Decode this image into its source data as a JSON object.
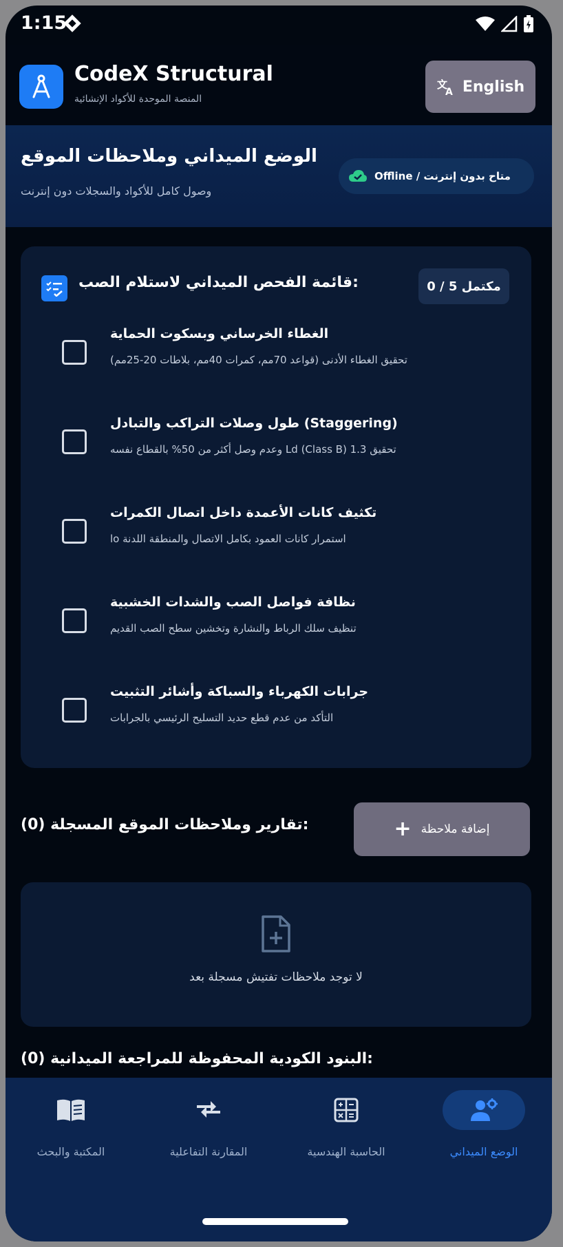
{
  "status_bar": {
    "time": "1:15"
  },
  "app": {
    "title": "CodeX Structural",
    "subtitle": "المنصة الموحدة للأكواد الإنشائية",
    "language_button": "English"
  },
  "banner": {
    "title": "الوضع الميداني وملاحظات الموقع",
    "subtitle": "وصول كامل للأكواد والسجلات دون إنترنت",
    "offline_badge": "Offline / متاح بدون إنترنت"
  },
  "checklist": {
    "title": "قائمة الفحص الميداني لاستلام الصب:",
    "progress": "مكتمل 5 / 0",
    "items": [
      {
        "title": "الغطاء الخرساني وبسكوت الحماية",
        "desc": "تحقيق الغطاء الأدنى (قواعد 70مم، كمرات 40مم، بلاطات 20-25مم)",
        "checked": false
      },
      {
        "title": "طول وصلات التراكب والتبادل (Staggering)",
        "desc": "وعدم وصل أكثر من 50% بالقطاع نفسه Ld (Class B) تحقيق 1.3",
        "checked": false
      },
      {
        "title": "تكثيف كانات الأعمدة داخل اتصال الكمرات",
        "desc": "lo استمرار كانات العمود بكامل الاتصال والمنطقة اللدنة",
        "checked": false
      },
      {
        "title": "نظافة فواصل الصب والشدات الخشبية",
        "desc": "تنظيف سلك الرباط والنشارة وتخشين سطح الصب القديم",
        "checked": false
      },
      {
        "title": "جرابات الكهرباء والسباكة وأشائر التثبيت",
        "desc": "التأكد من عدم قطع حديد التسليح الرئيسي بالجرابات",
        "checked": false
      }
    ]
  },
  "notes": {
    "title": "تقارير وملاحظات الموقع المسجلة (0):",
    "add_button": "إضافة ملاحظة",
    "empty_text": "لا توجد ملاحظات تفتيش مسجلة بعد"
  },
  "saved": {
    "title": "البنود الكودية المحفوظة للمراجعة الميدانية (0):"
  },
  "bottom_nav": {
    "items": [
      {
        "label": "المكتبة والبحث",
        "icon": "book-icon"
      },
      {
        "label": "المقارنة التفاعلية",
        "icon": "compare-arrows-icon"
      },
      {
        "label": "الحاسبة الهندسية",
        "icon": "calculator-icon"
      },
      {
        "label": "الوضع الميداني",
        "icon": "field-engineer-icon",
        "active": true
      }
    ]
  },
  "colors": {
    "accent": "#1e7cf5",
    "active_nav": "#3c8cff",
    "background": "#020811",
    "card": "#0b1a33"
  }
}
